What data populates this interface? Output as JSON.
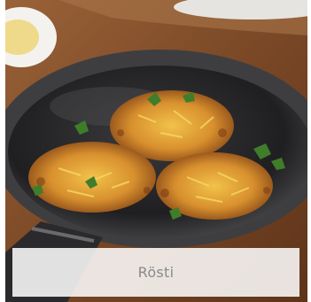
{
  "card": {
    "title": "Rösti"
  },
  "colors": {
    "caption_text": "#8a8a8a",
    "caption_bg": "#ffffff",
    "pan": "#2b2b2d",
    "table_wood": "#7a4a2a",
    "rosti": "#d48a2c",
    "herb": "#3f7d2a"
  }
}
